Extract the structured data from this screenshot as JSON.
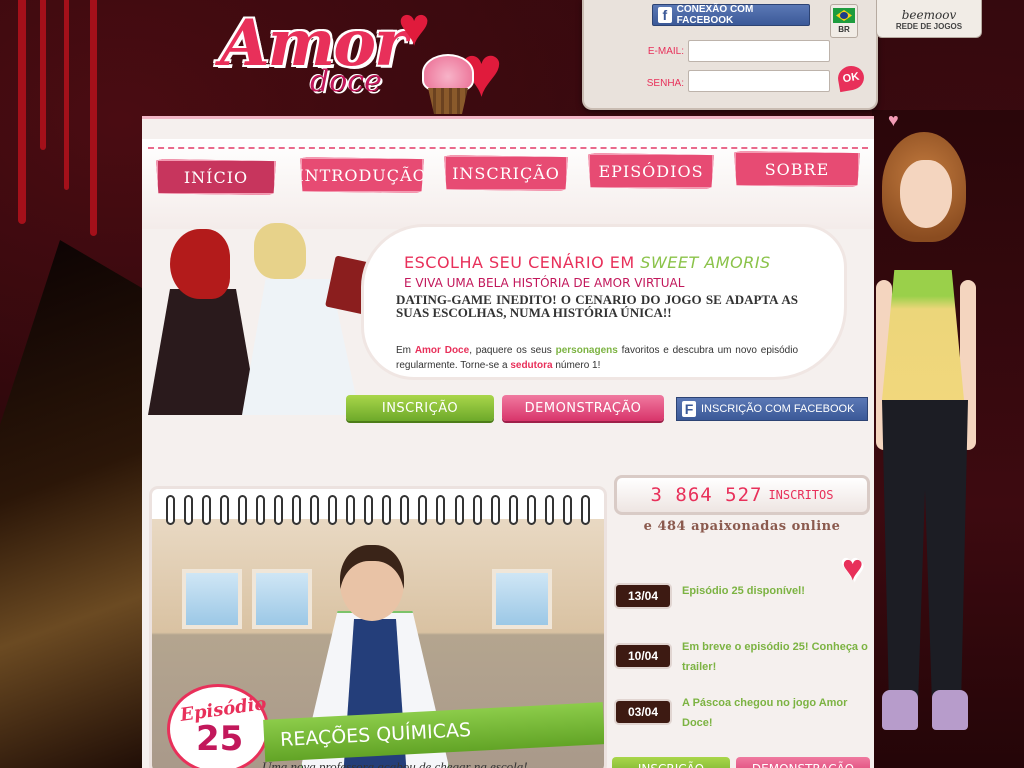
{
  "logo": {
    "word1": "Amor",
    "word2": "doce"
  },
  "login": {
    "facebook_connect": "CONEXÃO COM FACEBOOK",
    "email_label": "E-MAIL:",
    "password_label": "SENHA:",
    "ok_label": "OK",
    "email_value": "",
    "password_value": ""
  },
  "region": {
    "code": "BR"
  },
  "network": {
    "brand": "beemoov",
    "subtitle": "REDE DE JOGOS"
  },
  "nav": {
    "items": [
      {
        "label": "Início",
        "active": true
      },
      {
        "label": "Introdução",
        "active": false
      },
      {
        "label": "Inscrição",
        "active": false
      },
      {
        "label": "Episódios",
        "active": false
      },
      {
        "label": "Sobre",
        "active": false
      }
    ]
  },
  "promo": {
    "title_prefix": "ESCOLHA SEU CENÁRIO EM",
    "title_highlight": "SWEET AMORIS",
    "subtitle": "E VIVA UMA BELA HISTÓRIA DE AMOR VIRTUAL",
    "headline": "DATING-GAME INEDITO! O CENARIO DO JOGO SE ADAPTA AS SUAS ESCOLHAS, NUMA HISTÓRIA ÚNICA!!",
    "body_part1": "Em",
    "body_brand": "Amor Doce",
    "body_part2": ", paquere os seus",
    "body_keyword1": "personagens",
    "body_part3": "favoritos e descubra um novo episódio regularmente. Torne-se a",
    "body_keyword2": "sedutora",
    "body_part4": "número 1!",
    "signup_button": "INSCRIÇÃO",
    "demo_button": "DEMONSTRAÇÃO",
    "facebook_signup_button": "INSCRIÇÃO COM FACEBOOK"
  },
  "episode": {
    "word": "Episódio",
    "number": "25",
    "title": "REAÇÕES QUÍMICAS",
    "teaser": "Uma nova professora acabou de chegar na escola!"
  },
  "stats": {
    "subscribers": "3 864 527",
    "subscribers_label": "INSCRITOS",
    "online": "e 484 apaixonadas online"
  },
  "news": [
    {
      "date": "13/04",
      "text": "Episódio 25 disponível!"
    },
    {
      "date": "10/04",
      "text": "Em breve o episódio 25! Conheça o trailer!"
    },
    {
      "date": "03/04",
      "text": "A Páscoa chegou no jogo Amor Doce!"
    }
  ],
  "bottom_buttons": {
    "signup": "INSCRIÇÃO",
    "demo": "DEMONSTRAÇÃO"
  },
  "colors": {
    "accent_pink": "#e8305a",
    "accent_green": "#7cb342",
    "facebook_blue": "#3b5998",
    "page_bg": "#f5f0ee"
  }
}
